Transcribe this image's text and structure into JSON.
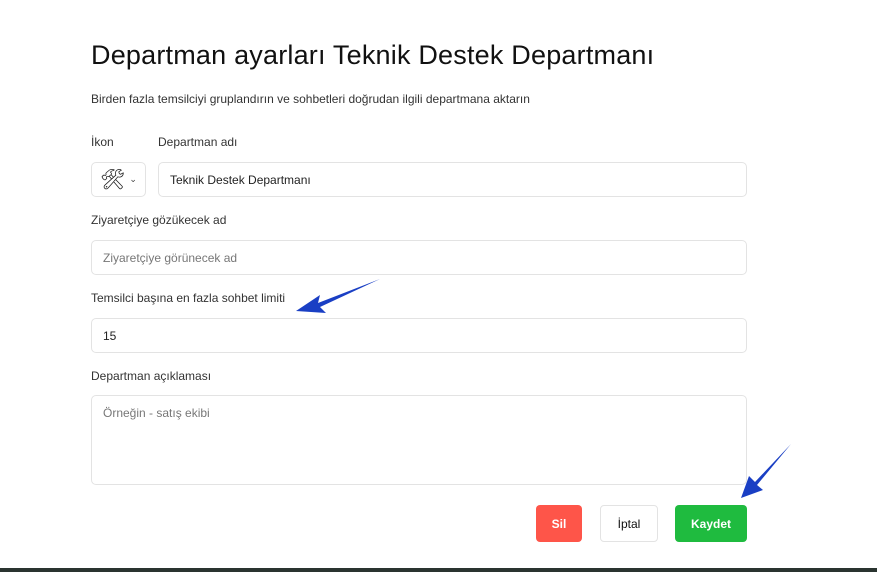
{
  "title": "Departman ayarları Teknik Destek Departmanı",
  "subtitle": "Birden fazla temsilciyi gruplandırın ve sohbetleri doğrudan ilgili departmana aktarın",
  "icon_label": "İkon",
  "icon_value": "🛠",
  "name_label": "Departman adı",
  "name_value": "Teknik Destek Departmanı",
  "visitor_label": "Ziyaretçiye gözükecek ad",
  "visitor_placeholder": "Ziyaretçiye görünecek ad",
  "limit_label": "Temsilci başına en fazla sohbet limiti",
  "limit_value": "15",
  "desc_label": "Departman açıklaması",
  "desc_placeholder": "Örneğin - satış ekibi",
  "buttons": {
    "delete": "Sil",
    "cancel": "İptal",
    "save": "Kaydet"
  },
  "colors": {
    "delete": "#fe5549",
    "save": "#1fbb3f",
    "arrow": "#1a3fc4"
  }
}
